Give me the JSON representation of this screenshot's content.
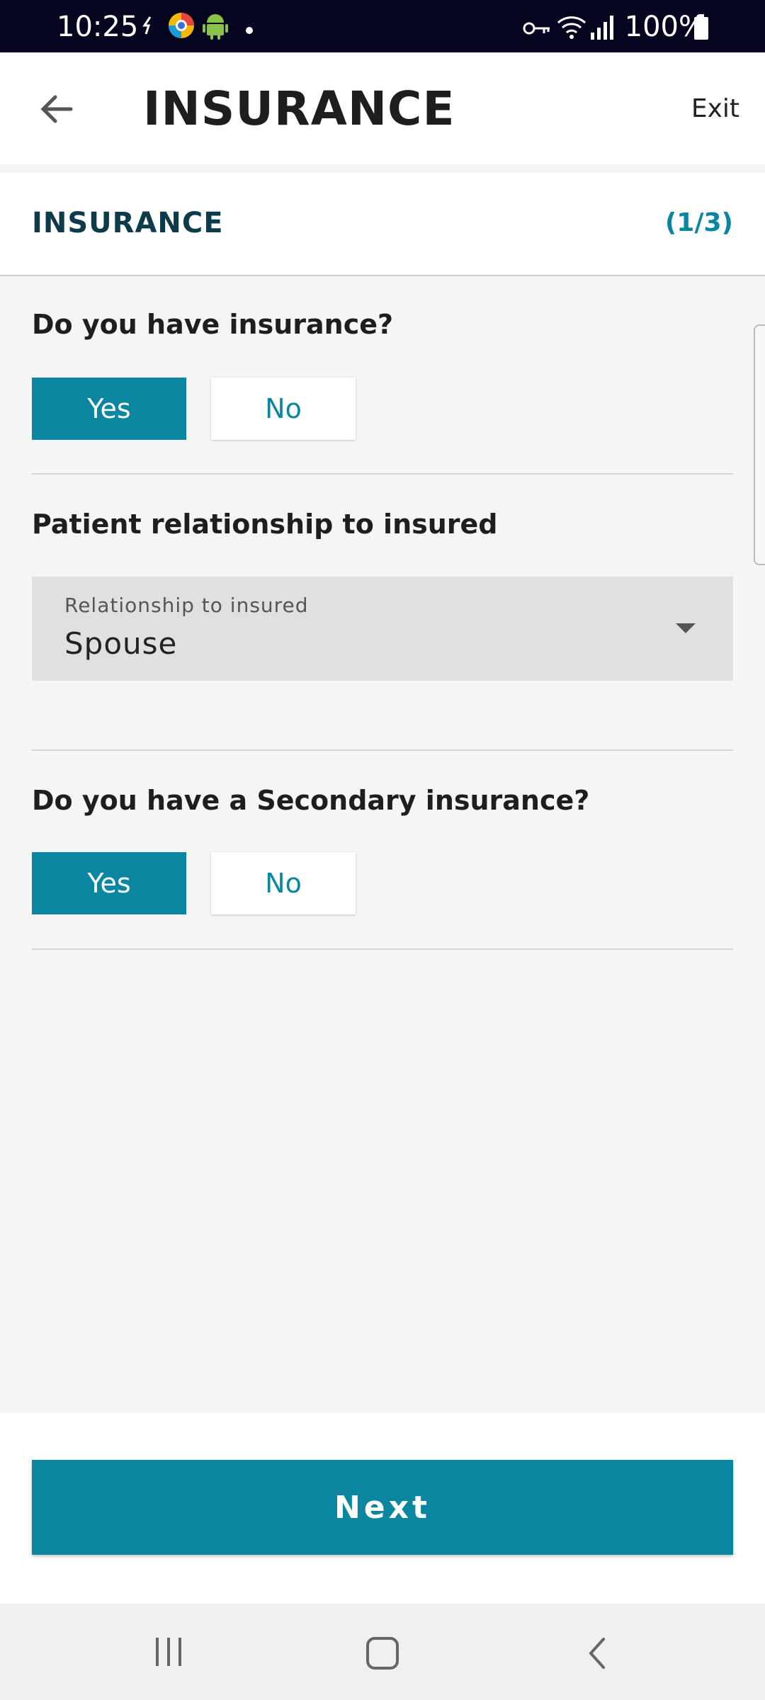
{
  "status_bar": {
    "time": "10:25",
    "battery": "100%",
    "icons": [
      "sync-icon",
      "browser-icon",
      "android-icon",
      "dot-icon",
      "key-icon",
      "wifi-icon",
      "signal-icon",
      "battery-icon"
    ]
  },
  "app_bar": {
    "title": "INSURANCE",
    "exit_label": "Exit",
    "back_icon": "arrow-left-icon"
  },
  "section": {
    "name": "INSURANCE",
    "step": "(1/3)"
  },
  "q1": {
    "question": "Do you have insurance?",
    "yes_label": "Yes",
    "no_label": "No",
    "selected": "Yes"
  },
  "relationship": {
    "question": "Patient relationship to insured",
    "field_label": "Relationship to insured",
    "value": "Spouse"
  },
  "q2": {
    "question": "Do you have a Secondary insurance?",
    "yes_label": "Yes",
    "no_label": "No",
    "selected": "Yes"
  },
  "footer": {
    "next_label": "Next"
  },
  "colors": {
    "accent": "#0a86a0",
    "status_bar": "#050520",
    "section_title": "#0d3b4a"
  }
}
